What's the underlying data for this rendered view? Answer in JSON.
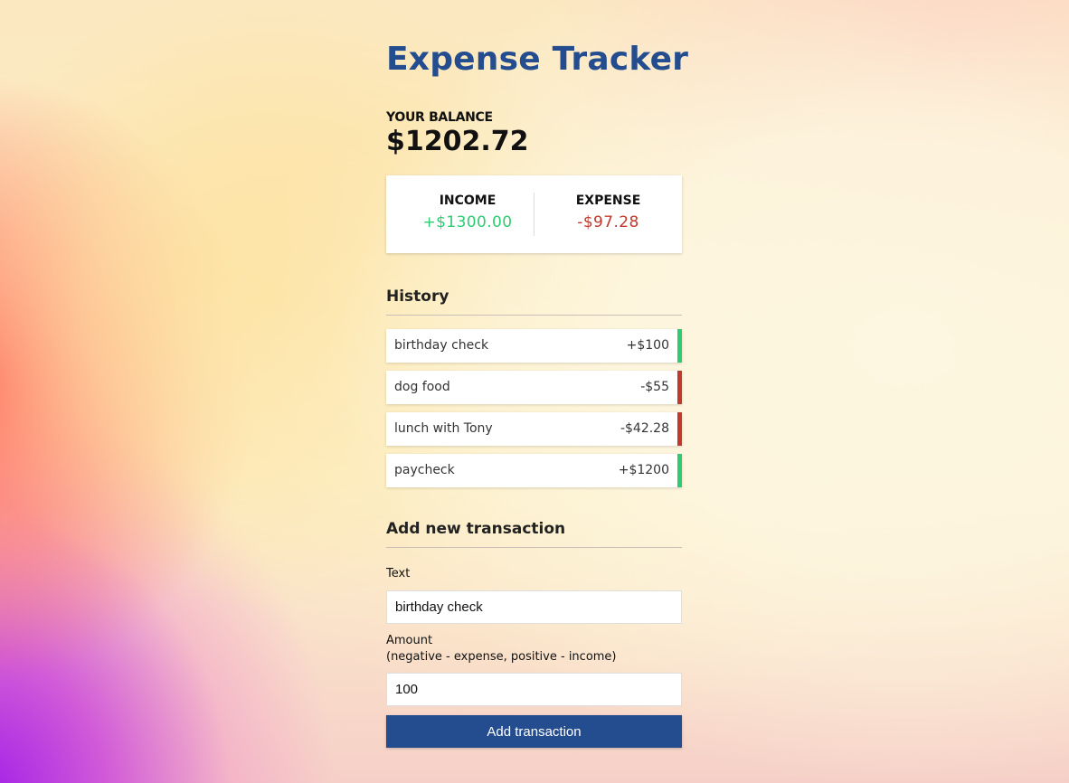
{
  "app": {
    "title": "Expense Tracker"
  },
  "balance": {
    "label": "YOUR BALANCE",
    "value": "$1202.72"
  },
  "summary": {
    "income_label": "INCOME",
    "income_value": "+$1300.00",
    "expense_label": "EXPENSE",
    "expense_value": "-$97.28"
  },
  "history": {
    "heading": "History",
    "items": [
      {
        "text": "birthday check",
        "amount": "+$100",
        "type": "plus"
      },
      {
        "text": "dog food",
        "amount": "-$55",
        "type": "minus"
      },
      {
        "text": "lunch with Tony",
        "amount": "-$42.28",
        "type": "minus"
      },
      {
        "text": "paycheck",
        "amount": "+$1200",
        "type": "plus"
      }
    ]
  },
  "form": {
    "heading": "Add new transaction",
    "text_label": "Text",
    "text_value": "birthday check",
    "amount_label_line1": "Amount",
    "amount_label_line2": "(negative - expense, positive - income)",
    "amount_value": "100",
    "submit_label": "Add transaction"
  },
  "colors": {
    "accent": "#234d8f",
    "plus": "#2ecc71",
    "minus": "#c0392b"
  }
}
